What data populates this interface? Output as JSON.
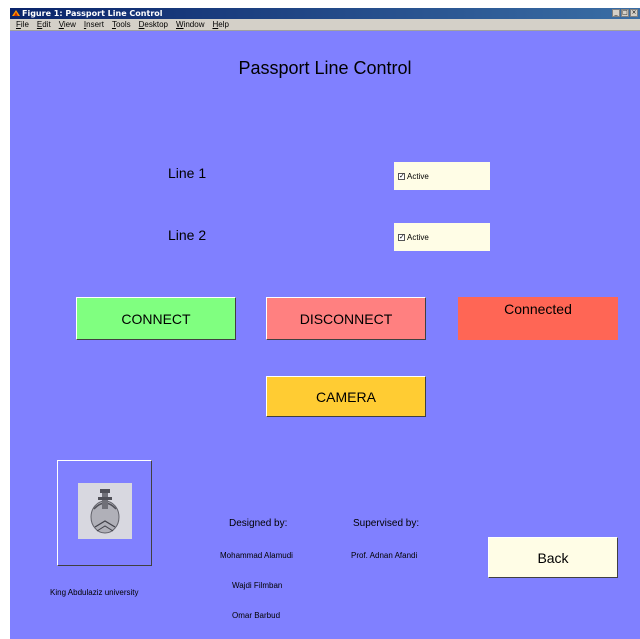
{
  "window": {
    "title": "Figure 1: Passport Line Control",
    "menu": [
      "File",
      "Edit",
      "View",
      "Insert",
      "Tools",
      "Desktop",
      "Window",
      "Help"
    ]
  },
  "app": {
    "title": "Passport Line Control",
    "lines": [
      {
        "label": "Line 1",
        "checkbox_label": "Active",
        "checked": true
      },
      {
        "label": "Line 2",
        "checkbox_label": "Active",
        "checked": true
      }
    ],
    "buttons": {
      "connect": "CONNECT",
      "disconnect": "DISCONNECT",
      "camera": "CAMERA",
      "back": "Back"
    },
    "status": "Connected",
    "university": "King Abdulaziz university",
    "credits": {
      "designed_heading": "Designed by:",
      "designers": [
        "Mohammad Alamudi",
        "Wajdi Filmban",
        "Omar Barbud"
      ],
      "supervised_heading": "Supervised by:",
      "supervisor": "Prof. Adnan Afandi"
    }
  },
  "colors": {
    "background": "#8080ff",
    "connect": "#80ff80",
    "disconnect": "#ff8080",
    "camera": "#ffcc33",
    "status": "#ff6655",
    "field": "#fffde6"
  },
  "icons": [
    "matlab-figure-icon",
    "university-logo"
  ]
}
